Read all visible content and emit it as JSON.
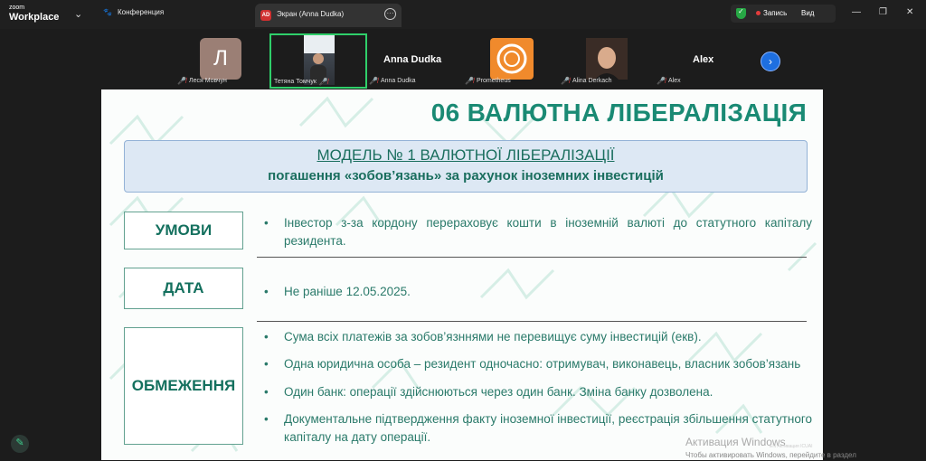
{
  "app": {
    "logo_line1": "zoom",
    "logo_line2": "Workplace",
    "conference_label": "Конференция",
    "tab_avatar": "AD",
    "tab_title": "Экран (Anna Dudka)",
    "record_label": "Запись",
    "view_label": "Вид"
  },
  "participants": [
    {
      "display": "Л",
      "name": "Леся Мовчун"
    },
    {
      "display": "",
      "name": "Тетяна Томчук"
    },
    {
      "display": "Anna Dudka",
      "name": "Anna Dudka"
    },
    {
      "display": "",
      "name": "Prometheus"
    },
    {
      "display": "",
      "name": "Alina Derkach"
    },
    {
      "display": "Alex",
      "name": "Alex"
    }
  ],
  "slide": {
    "title": "06 ВАЛЮТНА ЛІБЕРАЛІЗАЦІЯ",
    "model_title": "МОДЕЛЬ № 1 ВАЛЮТНОЇ ЛІБЕРАЛІЗАЦІЇ",
    "model_subtitle": "погашення «зобов’язань» за рахунок іноземних інвестицій",
    "sections": [
      {
        "label": "УМОВИ",
        "bullets": [
          "Інвестор з-за кордону перераховує кошти в іноземній валюті до статутного капіталу резидента."
        ]
      },
      {
        "label": "ДАТА",
        "bullets": [
          "Не раніше 12.05.2025."
        ]
      },
      {
        "label": "ОБМЕЖЕННЯ",
        "bullets": [
          "Сума всіх платежів за зобов’язннями не перевищує суму інвестицій (екв).",
          "Одна юридична особа – резидент одночасно: отримувач, виконавець, власник зобов’язань",
          "Один банк: операції здійснюються через один банк. Зміна банку дозволена.",
          "Документальне підтвердження факту іноземної інвестиції, реєстрація збільшення статутного капіталу на дату операції."
        ]
      }
    ]
  },
  "overlay": {
    "activate_title": "Активация Windows",
    "activate_sub": "Чтобы активировать Windows, перейдите в раздел",
    "lang": "EN Активация ICUAI"
  },
  "colors": {
    "accent": "#1a8a74",
    "highlight_border": "#2fcf6a",
    "record_dot": "#e23c3c"
  }
}
